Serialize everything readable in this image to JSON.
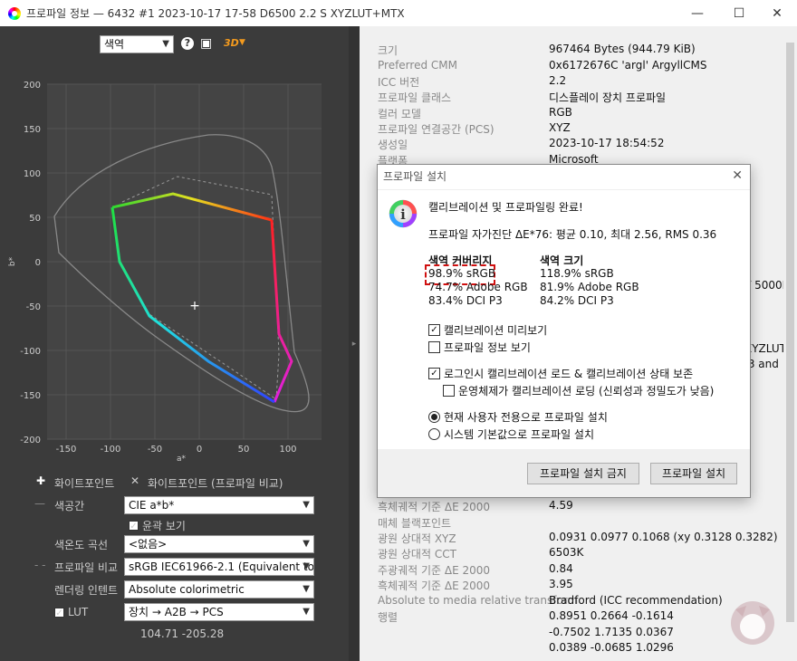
{
  "window": {
    "title": "프로파일 정보 — 6432 #1 2023-10-17 17-58 D6500 2.2 S XYZLUT+MTX",
    "minimize": "—",
    "maximize": "☐",
    "close": "✕"
  },
  "left": {
    "view_select": "색역",
    "help_icon": "?",
    "image_icon": "▣",
    "mode_3d": "3D",
    "chart": {
      "y_ticks": [
        "200",
        "150",
        "100",
        "50",
        "0",
        "-50",
        "-100",
        "-150",
        "-200"
      ],
      "x_ticks": [
        "-150",
        "-100",
        "-50",
        "0",
        "50",
        "100"
      ],
      "xlabel": "a*",
      "ylabel": "b*"
    },
    "legend_white": "화이트포인트",
    "legend_white_compare": "화이트포인트 (프로파일 비교)",
    "colorspace_label": "색공간",
    "colorspace_value": "CIE a*b*",
    "outline_label": "윤곽 보기",
    "cct_label": "색온도 곡선",
    "cct_value": "<없음>",
    "compare_label": "프로파일 비교",
    "compare_value": "sRGB IEC61966-2.1 (Equivalent to ww",
    "intent_label": "렌더링 인텐트",
    "intent_value": "Absolute colorimetric",
    "lut_label": "LUT",
    "lut_value": "장치 → A2B → PCS",
    "coords": "104.71 -205.28"
  },
  "props": [
    {
      "k": "크기",
      "v": "967464 Bytes (944.79 KiB)"
    },
    {
      "k": "Preferred CMM",
      "v": "0x6172676C 'argl' ArgyllCMS"
    },
    {
      "k": "ICC 버전",
      "v": "2.2"
    },
    {
      "k": "프로파일 클래스",
      "v": "디스플레이 장치 프로파일"
    },
    {
      "k": "컬러 모델",
      "v": "RGB"
    },
    {
      "k": "프로파일 연결공간 (PCS)",
      "v": "XYZ"
    },
    {
      "k": "생성일",
      "v": "2023-10-17 18:54:52"
    },
    {
      "k": "플랫폼",
      "v": "Microsoft"
    }
  ],
  "right_partial": {
    "a": "T 5000K",
    "b": "XYZLUT+I",
    "c": ".3 and"
  },
  "props_bottom": [
    {
      "k": "  흑체궤적 기준 ΔE 2000",
      "v": "4.59"
    },
    {
      "k": "매체 블랙포인트",
      "v": ""
    },
    {
      "k": "  광원 상대적 XYZ",
      "v": "0.0931 0.0977 0.1068 (xy 0.3128 0.3282)"
    },
    {
      "k": "  광원 상대적 CCT",
      "v": "6503K"
    },
    {
      "k": "    주광궤적 기준 ΔE 2000",
      "v": "0.84"
    },
    {
      "k": "    흑체궤적 기준 ΔE 2000",
      "v": "3.95"
    },
    {
      "k": "Absolute to media relative transform",
      "v": "Bradford (ICC recommendation)"
    },
    {
      "k": "  행렬",
      "v": "0.8951 0.2664 -0.1614"
    },
    {
      "k": "",
      "v": "-0.7502 1.7135 0.0367"
    },
    {
      "k": "",
      "v": "0.0389 -0.0685 1.0296"
    }
  ],
  "dialog": {
    "title": "프로파일 설치",
    "close": "✕",
    "heading": "캘리브레이션 및 프로파일링 완료!",
    "self_check": "프로파일 자가진단 ΔE*76: 평균 0.10, 최대 2.56, RMS 0.36",
    "coverage_header": "색역 커버리지",
    "size_header": "색역 크기",
    "coverage": [
      "98.9% sRGB",
      "74.7% Adobe RGB",
      "83.4% DCI P3"
    ],
    "size": [
      "118.9% sRGB",
      "81.9% Adobe RGB",
      "84.2% DCI P3"
    ],
    "opt_preview": "캘리브레이션 미리보기",
    "opt_show_info": "프로파일 정보 보기",
    "opt_login_load": "로그인시 캘리브레이션 로드 & 캘리브레이션 상태 보존",
    "opt_os_load": "운영체제가 캘리브레이션 로딩 (신뢰성과 정밀도가 낮음)",
    "radio_user": "현재 사용자 전용으로 프로파일 설치",
    "radio_system": "시스템 기본값으로 프로파일 설치",
    "btn_cancel": "프로파일 설치 금지",
    "btn_install": "프로파일 설치"
  }
}
